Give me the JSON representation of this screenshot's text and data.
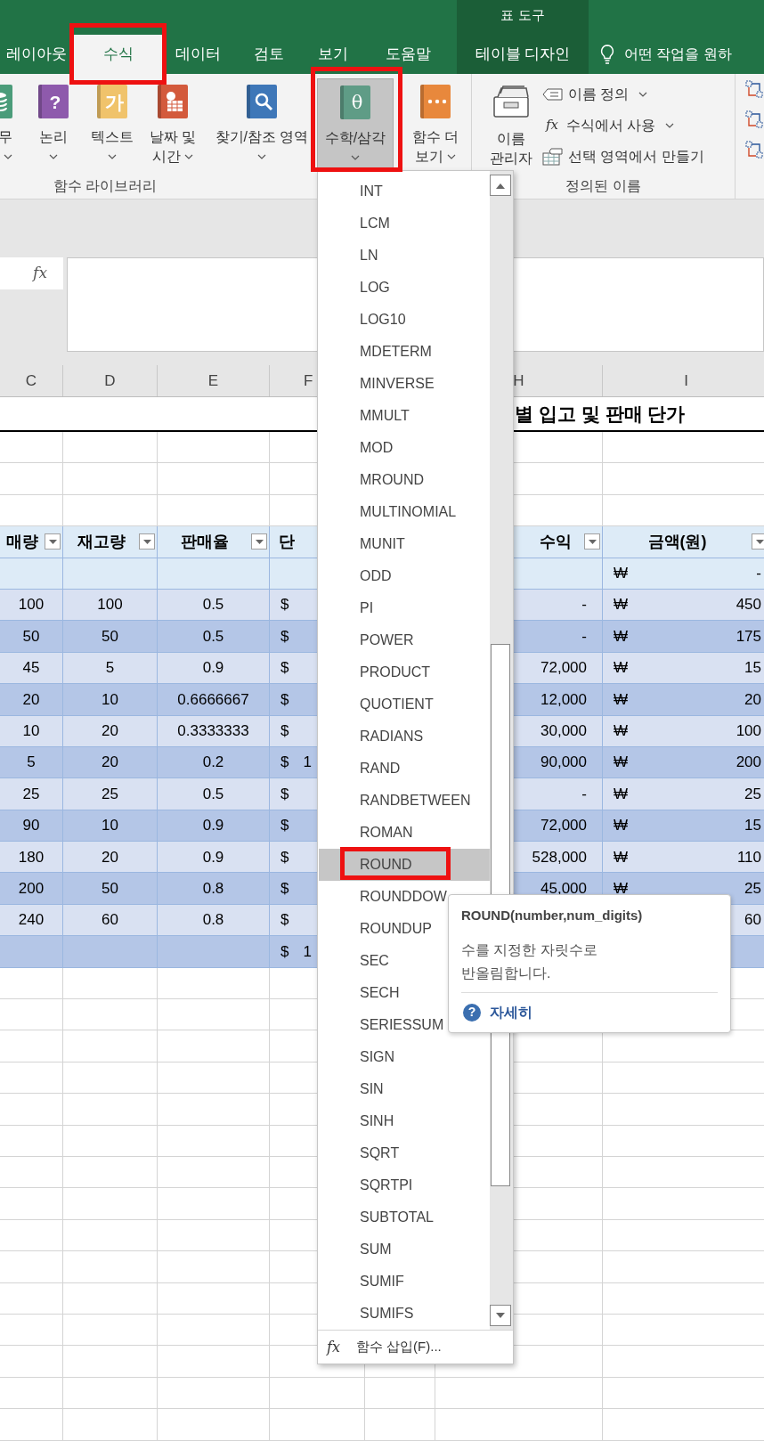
{
  "tabs": [
    {
      "label": "레이아웃",
      "kind": "standard",
      "selected": false,
      "highlighted": false
    },
    {
      "label": "수식",
      "kind": "standard",
      "selected": true,
      "highlighted": true
    },
    {
      "label": "데이터",
      "kind": "standard",
      "selected": false,
      "highlighted": false
    },
    {
      "label": "검토",
      "kind": "standard",
      "selected": false,
      "highlighted": false
    },
    {
      "label": "보기",
      "kind": "standard",
      "selected": false,
      "highlighted": false
    },
    {
      "label": "도움말",
      "kind": "standard",
      "selected": false,
      "highlighted": false
    },
    {
      "label": "테이블 디자인",
      "kind": "contextual",
      "group_label": "표 도구",
      "selected": false,
      "highlighted": false
    }
  ],
  "tell_me": {
    "text": "어떤 작업을 원하"
  },
  "ribbon": {
    "groups": [
      {
        "label": "함수 라이브러리",
        "buttons": [
          {
            "lines": [
              "무"
            ],
            "kind": "database",
            "dropdown": true,
            "selected": false,
            "highlighted": false
          },
          {
            "lines": [
              "논리"
            ],
            "kind": "logic",
            "glyph": "?",
            "dropdown": true,
            "selected": false,
            "highlighted": false
          },
          {
            "lines": [
              "텍스트"
            ],
            "kind": "text",
            "glyph": "가",
            "dropdown": true,
            "selected": false,
            "highlighted": false
          },
          {
            "lines": [
              "날짜 및",
              "시간"
            ],
            "kind": "calendar",
            "dropdown": true,
            "selected": false,
            "highlighted": false
          },
          {
            "lines": [
              "찾기/참조 영역"
            ],
            "kind": "lookup",
            "dropdown": true,
            "selected": false,
            "highlighted": false
          },
          {
            "lines": [
              "수학/삼각"
            ],
            "kind": "math",
            "glyph": "θ",
            "dropdown": true,
            "selected": true,
            "highlighted": true
          },
          {
            "lines": [
              "함수 더",
              "보기"
            ],
            "kind": "more",
            "dropdown": true,
            "selected": false,
            "highlighted": false
          }
        ]
      },
      {
        "label": "정의된 이름",
        "buttons": [
          {
            "lines": [
              "이름",
              "관리자"
            ],
            "kind": "name_manager",
            "dropdown": false,
            "selected": false,
            "highlighted": false
          }
        ],
        "commands": [
          {
            "label": "이름 정의",
            "kind": "tag",
            "dropdown": true
          },
          {
            "label": "수식에서 사용",
            "kind": "fx",
            "glyph": "fx",
            "dropdown": true
          },
          {
            "label": "선택 영역에서 만들기",
            "kind": "table",
            "dropdown": false
          }
        ]
      }
    ]
  },
  "formula_bar": {
    "fx_label": "fx"
  },
  "sheet": {
    "columns": [
      {
        "letter": "C"
      },
      {
        "letter": "D"
      },
      {
        "letter": "E"
      },
      {
        "letter": "F"
      },
      {
        "letter": "H"
      },
      {
        "letter": "I"
      }
    ],
    "title": "별 입고 및 판매 단가",
    "header": [
      {
        "text": "매량",
        "filter": true
      },
      {
        "text": "재고량",
        "filter": true
      },
      {
        "text": "판매율",
        "filter": true
      },
      {
        "text": "단"
      },
      {
        "text": "수익",
        "filter": true
      },
      {
        "text": "금액(원)",
        "filter": true
      }
    ],
    "rows": [
      {
        "kind": "blank",
        "i_currency": "₩",
        "i": "-"
      },
      {
        "kind": "data",
        "c": "100",
        "d": "100",
        "e": "0.5",
        "f": "$",
        "h": "-",
        "i_currency": "₩",
        "i": "450"
      },
      {
        "kind": "data",
        "c": "50",
        "d": "50",
        "e": "0.5",
        "f": "$",
        "h": "-",
        "i_currency": "₩",
        "i": "175"
      },
      {
        "kind": "data",
        "c": "45",
        "d": "5",
        "e": "0.9",
        "f": "$",
        "h": "72,000",
        "i_currency": "₩",
        "i": "15"
      },
      {
        "kind": "data",
        "c": "20",
        "d": "10",
        "e": "0.6666667",
        "f": "$",
        "h": "12,000",
        "i_currency": "₩",
        "i": "20"
      },
      {
        "kind": "data",
        "c": "10",
        "d": "20",
        "e": "0.3333333",
        "f": "$",
        "h": "30,000",
        "i_currency": "₩",
        "i": "100"
      },
      {
        "kind": "data",
        "c": "5",
        "d": "20",
        "e": "0.2",
        "f": "$",
        "f_amount": "1",
        "h": "90,000",
        "i_currency": "₩",
        "i": "200"
      },
      {
        "kind": "data",
        "c": "25",
        "d": "25",
        "e": "0.5",
        "f": "$",
        "h": "-",
        "i_currency": "₩",
        "i": "25"
      },
      {
        "kind": "data",
        "c": "90",
        "d": "10",
        "e": "0.9",
        "f": "$",
        "h": "72,000",
        "i_currency": "₩",
        "i": "15"
      },
      {
        "kind": "data",
        "c": "180",
        "d": "20",
        "e": "0.9",
        "f": "$",
        "h": "528,000",
        "i_currency": "₩",
        "i": "110"
      },
      {
        "kind": "data",
        "c": "200",
        "d": "50",
        "e": "0.8",
        "f": "$",
        "h": "45,000",
        "i_currency": "₩",
        "i": "25"
      },
      {
        "kind": "data",
        "c": "240",
        "d": "60",
        "e": "0.8",
        "f": "$",
        "i": "60"
      },
      {
        "kind": "total",
        "f": "$",
        "f_amount": "1"
      }
    ]
  },
  "menu": {
    "items": [
      {
        "label": "INT",
        "selected": false,
        "highlighted": false
      },
      {
        "label": "LCM",
        "selected": false,
        "highlighted": false
      },
      {
        "label": "LN",
        "selected": false,
        "highlighted": false
      },
      {
        "label": "LOG",
        "selected": false,
        "highlighted": false
      },
      {
        "label": "LOG10",
        "selected": false,
        "highlighted": false
      },
      {
        "label": "MDETERM",
        "selected": false,
        "highlighted": false
      },
      {
        "label": "MINVERSE",
        "selected": false,
        "highlighted": false
      },
      {
        "label": "MMULT",
        "selected": false,
        "highlighted": false
      },
      {
        "label": "MOD",
        "selected": false,
        "highlighted": false
      },
      {
        "label": "MROUND",
        "selected": false,
        "highlighted": false
      },
      {
        "label": "MULTINOMIAL",
        "selected": false,
        "highlighted": false
      },
      {
        "label": "MUNIT",
        "selected": false,
        "highlighted": false
      },
      {
        "label": "ODD",
        "selected": false,
        "highlighted": false
      },
      {
        "label": "PI",
        "selected": false,
        "highlighted": false
      },
      {
        "label": "POWER",
        "selected": false,
        "highlighted": false
      },
      {
        "label": "PRODUCT",
        "selected": false,
        "highlighted": false
      },
      {
        "label": "QUOTIENT",
        "selected": false,
        "highlighted": false
      },
      {
        "label": "RADIANS",
        "selected": false,
        "highlighted": false
      },
      {
        "label": "RAND",
        "selected": false,
        "highlighted": false
      },
      {
        "label": "RANDBETWEEN",
        "selected": false,
        "highlighted": false
      },
      {
        "label": "ROMAN",
        "selected": false,
        "highlighted": false
      },
      {
        "label": "ROUND",
        "selected": true,
        "highlighted": true
      },
      {
        "label": "ROUNDDOW",
        "selected": false,
        "highlighted": false
      },
      {
        "label": "ROUNDUP",
        "selected": false,
        "highlighted": false
      },
      {
        "label": "SEC",
        "selected": false,
        "highlighted": false
      },
      {
        "label": "SECH",
        "selected": false,
        "highlighted": false
      },
      {
        "label": "SERIESSUM",
        "selected": false,
        "highlighted": false
      },
      {
        "label": "SIGN",
        "selected": false,
        "highlighted": false
      },
      {
        "label": "SIN",
        "selected": false,
        "highlighted": false
      },
      {
        "label": "SINH",
        "selected": false,
        "highlighted": false
      },
      {
        "label": "SQRT",
        "selected": false,
        "highlighted": false
      },
      {
        "label": "SQRTPI",
        "selected": false,
        "highlighted": false
      },
      {
        "label": "SUBTOTAL",
        "selected": false,
        "highlighted": false
      },
      {
        "label": "SUM",
        "selected": false,
        "highlighted": false
      },
      {
        "label": "SUMIF",
        "selected": false,
        "highlighted": false
      },
      {
        "label": "SUMIFS",
        "selected": false,
        "highlighted": false
      }
    ],
    "footer": {
      "glyph": "fx",
      "label": "함수 삽입(F)..."
    }
  },
  "tooltip": {
    "title": "ROUND(number,num_digits)",
    "description": "수를 지정한 자릿수로 반올림합니다.",
    "help_glyph": "?",
    "link": "자세히"
  }
}
